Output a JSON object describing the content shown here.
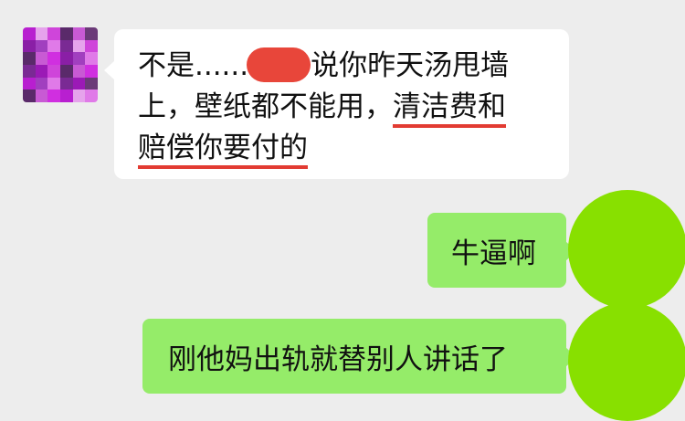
{
  "messages": [
    {
      "side": "left",
      "line1_pre": "不是......",
      "line1_post": "说你昨天汤甩墙",
      "line2_pre": "上，壁纸都不能用，",
      "line2_underlined": "清洁费和",
      "line3_underlined": "赔偿你要付的"
    },
    {
      "side": "right",
      "text": "牛逼啊"
    },
    {
      "side": "right",
      "text": "刚他妈出轨就替别人讲话了"
    }
  ],
  "colors": {
    "background": "#ededed",
    "incoming_bubble": "#ffffff",
    "outgoing_bubble": "#95ec69",
    "underline": "#e23b32",
    "redaction": "#e8463a",
    "outgoing_avatar": "#88e000"
  }
}
